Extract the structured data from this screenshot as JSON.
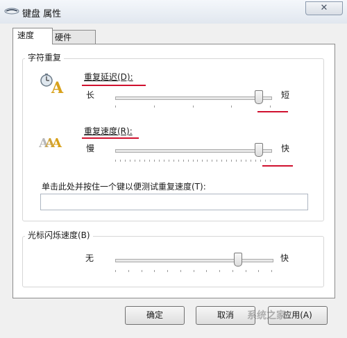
{
  "window": {
    "title": "键盘 属性",
    "close_glyph": "✕"
  },
  "tabs": [
    {
      "label": "速度",
      "active": true
    },
    {
      "label": "硬件",
      "active": false
    }
  ],
  "repeat_group": {
    "title": "字符重复",
    "delay": {
      "label": "重复延迟(D):",
      "min_label": "长",
      "max_label": "短",
      "level": 0.95
    },
    "rate": {
      "label": "重复速度(R):",
      "min_label": "慢",
      "max_label": "快",
      "level": 0.95
    },
    "test_prompt": "单击此处并按住一个键以便测试重复速度(T):",
    "test_value": ""
  },
  "cursor_group": {
    "title": "光标闪烁速度(B)",
    "min_label": "无",
    "max_label": "快",
    "level": 0.8
  },
  "buttons": {
    "ok": "确定",
    "cancel": "取消",
    "apply": "应用(A)"
  },
  "watermark": "系统之家",
  "colors": {
    "annotation_red": "#d0102e",
    "window_frame": "#cfd8e3"
  }
}
